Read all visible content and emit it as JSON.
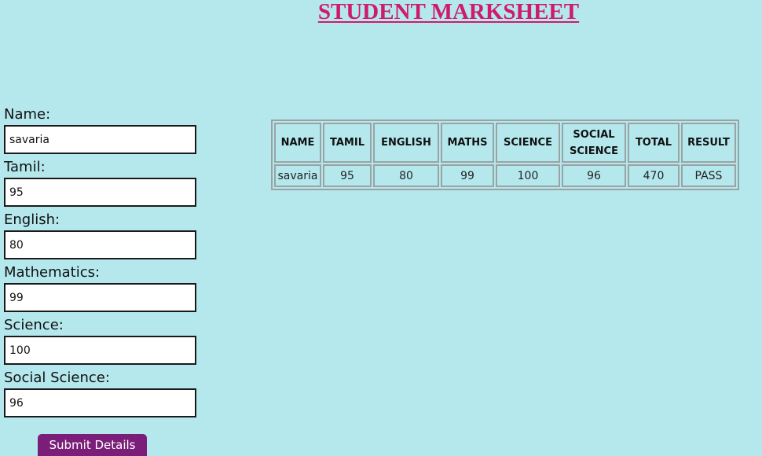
{
  "page": {
    "title": "STUDENT MARKSHEET"
  },
  "form": {
    "fields": [
      {
        "label": "Name:",
        "value": "savaria"
      },
      {
        "label": "Tamil:",
        "value": "95"
      },
      {
        "label": "English:",
        "value": "80"
      },
      {
        "label": "Mathematics:",
        "value": "99"
      },
      {
        "label": "Science:",
        "value": "100"
      },
      {
        "label": "Social Science:",
        "value": "96"
      }
    ],
    "submit_label": "Submit Details"
  },
  "table": {
    "headers": [
      "NAME",
      "TAMIL",
      "ENGLISH",
      "MATHS",
      "SCIENCE",
      "SOCIAL SCIENCE",
      "TOTAL",
      "RESULT"
    ],
    "rows": [
      [
        "savaria",
        "95",
        "80",
        "99",
        "100",
        "96",
        "470",
        "PASS"
      ]
    ]
  },
  "colors": {
    "background": "#b5e8ed",
    "title": "#d01a6a",
    "button": "#7b1e7a"
  }
}
